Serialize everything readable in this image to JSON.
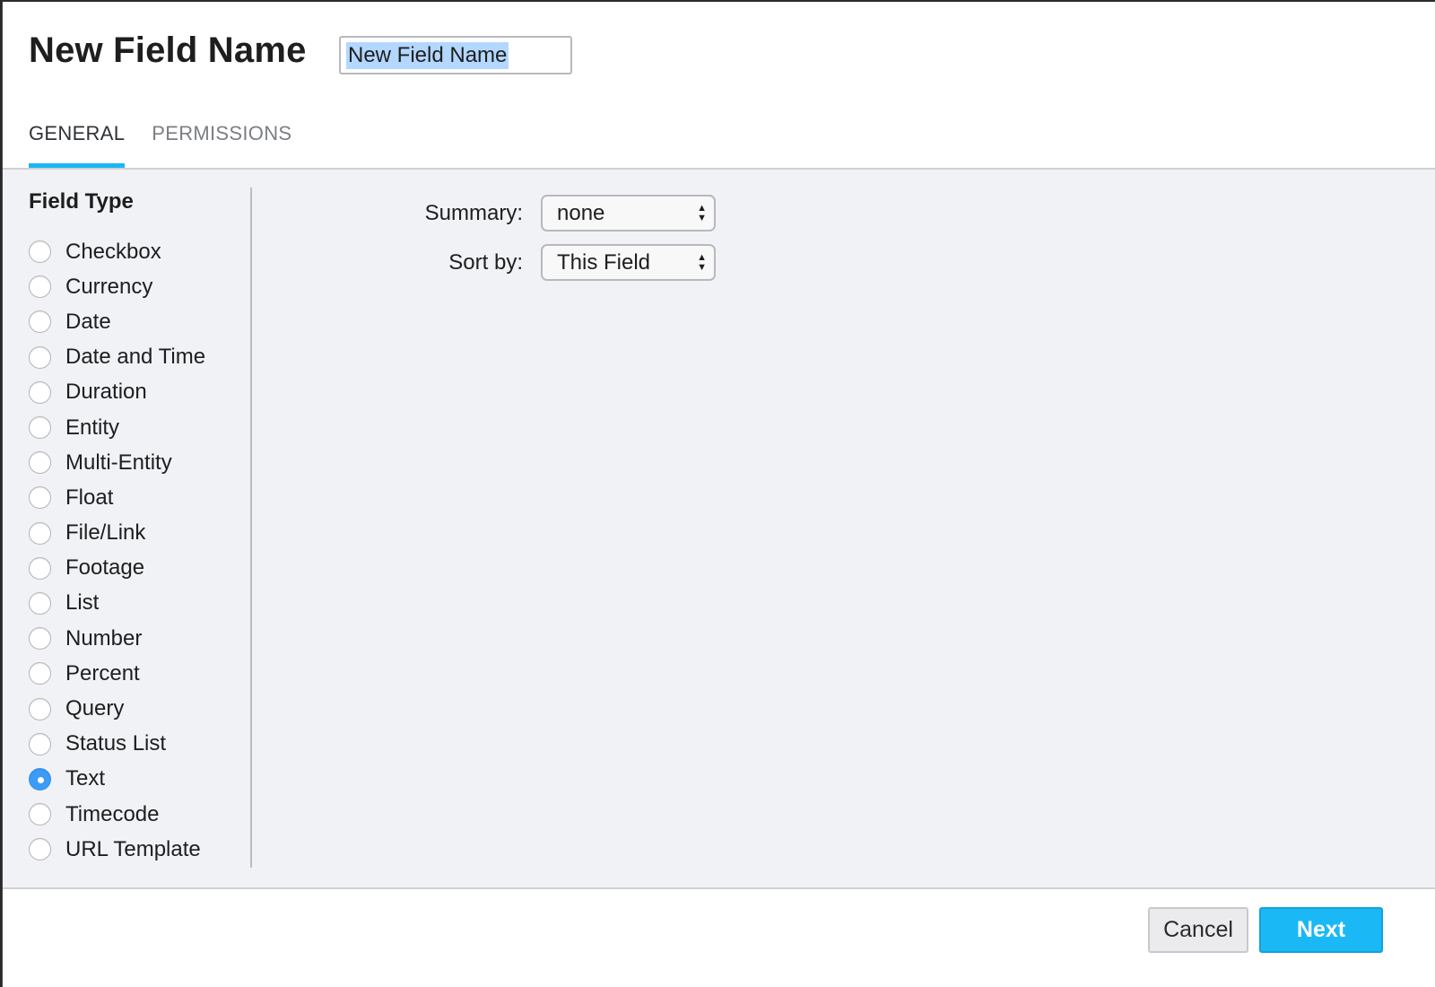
{
  "dialog": {
    "title": "New Field Name",
    "name_input_value": "New Field Name"
  },
  "tabs": [
    {
      "label": "GENERAL",
      "active": true
    },
    {
      "label": "PERMISSIONS",
      "active": false
    }
  ],
  "field_type": {
    "heading": "Field Type",
    "selected": "Text",
    "options": [
      {
        "label": "Checkbox",
        "checked": false
      },
      {
        "label": "Currency",
        "checked": false
      },
      {
        "label": "Date",
        "checked": false
      },
      {
        "label": "Date and Time",
        "checked": false
      },
      {
        "label": "Duration",
        "checked": false
      },
      {
        "label": "Entity",
        "checked": false
      },
      {
        "label": "Multi-Entity",
        "checked": false
      },
      {
        "label": "Float",
        "checked": false
      },
      {
        "label": "File/Link",
        "checked": false
      },
      {
        "label": "Footage",
        "checked": false
      },
      {
        "label": "List",
        "checked": false
      },
      {
        "label": "Number",
        "checked": false
      },
      {
        "label": "Percent",
        "checked": false
      },
      {
        "label": "Query",
        "checked": false
      },
      {
        "label": "Status List",
        "checked": false
      },
      {
        "label": "Text",
        "checked": true
      },
      {
        "label": "Timecode",
        "checked": false
      },
      {
        "label": "URL Template",
        "checked": false
      }
    ]
  },
  "settings": {
    "summary": {
      "label": "Summary:",
      "value": "none"
    },
    "sort_by": {
      "label": "Sort by:",
      "value": "This Field"
    }
  },
  "footer": {
    "cancel_label": "Cancel",
    "next_label": "Next"
  },
  "icons": {
    "select_arrow_up": "▲",
    "select_arrow_down": "▼"
  },
  "colors": {
    "accent": "#1ab7f4",
    "radio_checked": "#3c9bf6",
    "next_button": "#1bb8f6",
    "selection_highlight": "#b3d7ff"
  }
}
